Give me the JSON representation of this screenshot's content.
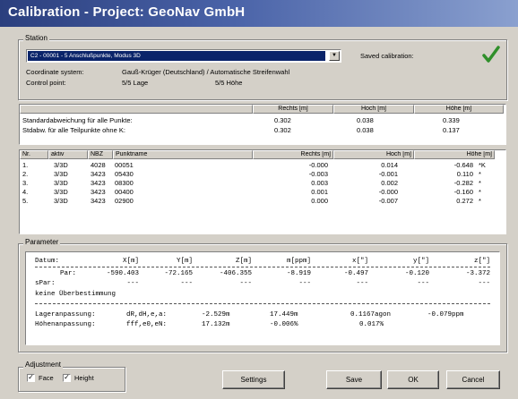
{
  "title": "Calibration - Project: GeoNav GmbH",
  "station": {
    "group_label": "Station",
    "selected": "C2 - 00001 - 5 Anschlußpunkte, Modus 3D",
    "saved_label": "Saved calibration:",
    "saved_icon": "checkmark-icon",
    "coord_label": "Coordinate system:",
    "coord_value": "Gauß-Krüger (Deutschland) / Automatische Streifenwahl",
    "control_label": "Control point:",
    "control_lage": "5/5 Lage",
    "control_hoehe": "5/5 Höhe"
  },
  "stats": {
    "headers": [
      "Rechts [m]",
      "Hoch [m]",
      "Höhe [m]"
    ],
    "rows": [
      {
        "label": "Standardabweichung für alle Punkte:",
        "rechts": "0.302",
        "hoch": "0.038",
        "hoehe": "0.339"
      },
      {
        "label": "Stdabw. für alle Teilpunkte ohne K:",
        "rechts": "0.302",
        "hoch": "0.038",
        "hoehe": "0.137"
      }
    ]
  },
  "points": {
    "headers": [
      "Nr.",
      "aktiv",
      "NBZ",
      "Punktname",
      "Rechts [m]",
      "Hoch [m]",
      "Höhe [m]"
    ],
    "rows": [
      {
        "nr": "1.",
        "aktiv": "3/3D",
        "nbz": "4028",
        "name": "00051",
        "rechts": "-0.000",
        "hoch": "0.014",
        "hoehe": "-0.648",
        "flag": "*K"
      },
      {
        "nr": "2.",
        "aktiv": "3/3D",
        "nbz": "3423",
        "name": "05430",
        "rechts": "-0.003",
        "hoch": "-0.001",
        "hoehe": "0.110",
        "flag": "*"
      },
      {
        "nr": "3.",
        "aktiv": "3/3D",
        "nbz": "3423",
        "name": "08300",
        "rechts": "0.003",
        "hoch": "0.002",
        "hoehe": "-0.282",
        "flag": "*"
      },
      {
        "nr": "4.",
        "aktiv": "3/3D",
        "nbz": "3423",
        "name": "00400",
        "rechts": "0.001",
        "hoch": "-0.000",
        "hoehe": "-0.160",
        "flag": "*"
      },
      {
        "nr": "5.",
        "aktiv": "3/3D",
        "nbz": "3423",
        "name": "02900",
        "rechts": "0.000",
        "hoch": "-0.007",
        "hoehe": "0.272",
        "flag": "*"
      }
    ]
  },
  "parameter": {
    "group_label": "Parameter",
    "datum_row": [
      "Datum:",
      "X[m]",
      "Y[m]",
      "Z[m]",
      "m[ppm]",
      "x[\"]",
      "y[\"]",
      "z[\"]"
    ],
    "par_row": [
      "Par:",
      "-590.403",
      "-72.165",
      "-406.355",
      "-8.919",
      "-0.497",
      "-0.120",
      "-3.372"
    ],
    "spar_row": [
      "sPar:",
      "---",
      "---",
      "---",
      "---",
      "---",
      "---",
      "---"
    ],
    "note": "keine Überbestimmung",
    "lage_label": "Lageranpassung:",
    "lage_params": "dR,dH,e,a:",
    "lage_values": [
      "-2.529m",
      "17.449m",
      "0.1167agon",
      "-0.079ppm"
    ],
    "hoehe_label": "Höhenanpassung:",
    "hoehe_params": "fff,e0,eN:",
    "hoehe_values": [
      "17.132m",
      "-0.006%",
      "0.017%"
    ]
  },
  "adjustment": {
    "group_label": "Adjustment",
    "face_label": "Face",
    "face_checked": true,
    "height_label": "Height",
    "height_checked": true
  },
  "buttons": {
    "settings": "Settings",
    "save": "Save",
    "ok": "OK",
    "cancel": "Cancel"
  }
}
